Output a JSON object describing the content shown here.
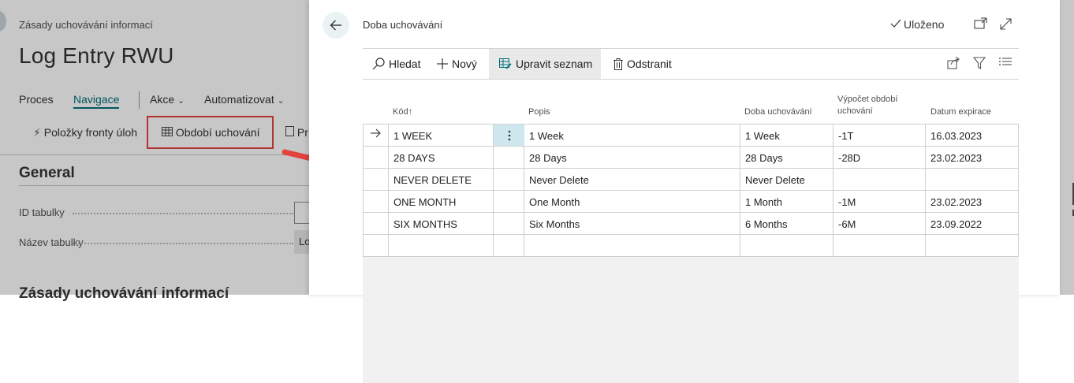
{
  "background_page": {
    "subtitle": "Zásady uchovávání informací",
    "title": "Log Entry RWU",
    "menu": [
      "Proces",
      "Navigace",
      "Akce",
      "Automatizovat"
    ],
    "actions": [
      "Položky fronty úloh",
      "Období uchování",
      "Pr"
    ],
    "section": "General",
    "fields": [
      {
        "label": "ID tabulky",
        "value": ""
      },
      {
        "label": "Název tabulky",
        "value": "Lo"
      }
    ],
    "bottom_section": "Zásady uchovávání informací"
  },
  "panel": {
    "title": "Doba uchovávání",
    "saved_label": "Uloženo",
    "toolbar": {
      "search": "Hledat",
      "new": "Nový",
      "edit_list": "Upravit seznam",
      "delete": "Odstranit"
    },
    "columns": {
      "code": "Kód",
      "code_sort": "↑",
      "description": "Popis",
      "period": "Doba uchovávání",
      "formula": "Výpočet období uchování",
      "expiry": "Datum expirace"
    },
    "rows": [
      {
        "code": "1 WEEK",
        "description": "1 Week",
        "period": "1 Week",
        "formula": "-1T",
        "expiry": "16.03.2023",
        "selected": true
      },
      {
        "code": "28 DAYS",
        "description": "28 Days",
        "period": "28 Days",
        "formula": "-28D",
        "expiry": "23.02.2023"
      },
      {
        "code": "NEVER DELETE",
        "description": "Never Delete",
        "period": "Never Delete",
        "formula": "",
        "expiry": ""
      },
      {
        "code": "ONE MONTH",
        "description": "One Month",
        "period": "1 Month",
        "formula": "-1M",
        "expiry": "23.02.2023"
      },
      {
        "code": "SIX MONTHS",
        "description": "Six Months",
        "period": "6 Months",
        "formula": "-6M",
        "expiry": "23.09.2022"
      }
    ]
  },
  "colors": {
    "accent": "#00707a",
    "highlight_box": "#e2433f",
    "selected_cell": "#cfe8ef"
  }
}
